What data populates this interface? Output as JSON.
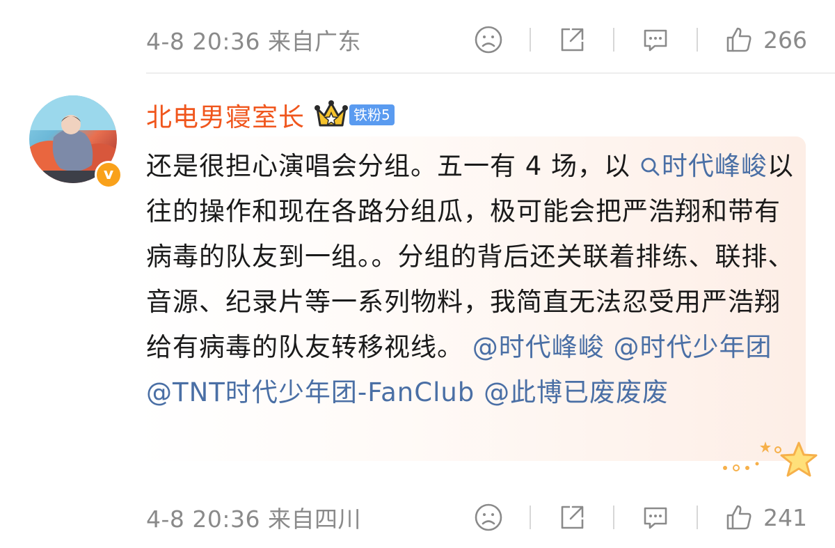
{
  "prev_comment": {
    "meta": "4-8 20:36 来自广东",
    "like_count": "266"
  },
  "comment": {
    "username": "北电男寝室长",
    "fan_badge": "铁粉5",
    "verified_mark": "v",
    "text_1": "还是很担心演唱会分组。五一有 4 场，以 ",
    "topic_link": "时代峰峻",
    "text_2": "以往的操作和现在各路分组瓜，极可能会把严浩翔和带有病毒的队友到一组。。分组的背后还关联着排练、联排、音源、纪录片等一系列物料，我简直无法忍受用严浩翔给有病毒的队友转移视线。",
    "mention_1": "@时代峰峻",
    "mention_2": "@时代少年团",
    "mention_3": "@TNT时代少年团-FanClub",
    "mention_4": "@此博已废废废",
    "meta": "4-8 20:36 来自四川",
    "like_count": "241"
  },
  "icons": [
    "dislike-face-icon",
    "share-icon",
    "comment-icon",
    "like-thumb-icon",
    "crown-icon",
    "search-icon",
    "sparkle-stars-icon"
  ],
  "colors": {
    "username": "#f0561d",
    "link": "#4a6fa5",
    "badge": "#5a9bf0",
    "verified": "#f9a11b",
    "meta": "#8a8a8a"
  }
}
